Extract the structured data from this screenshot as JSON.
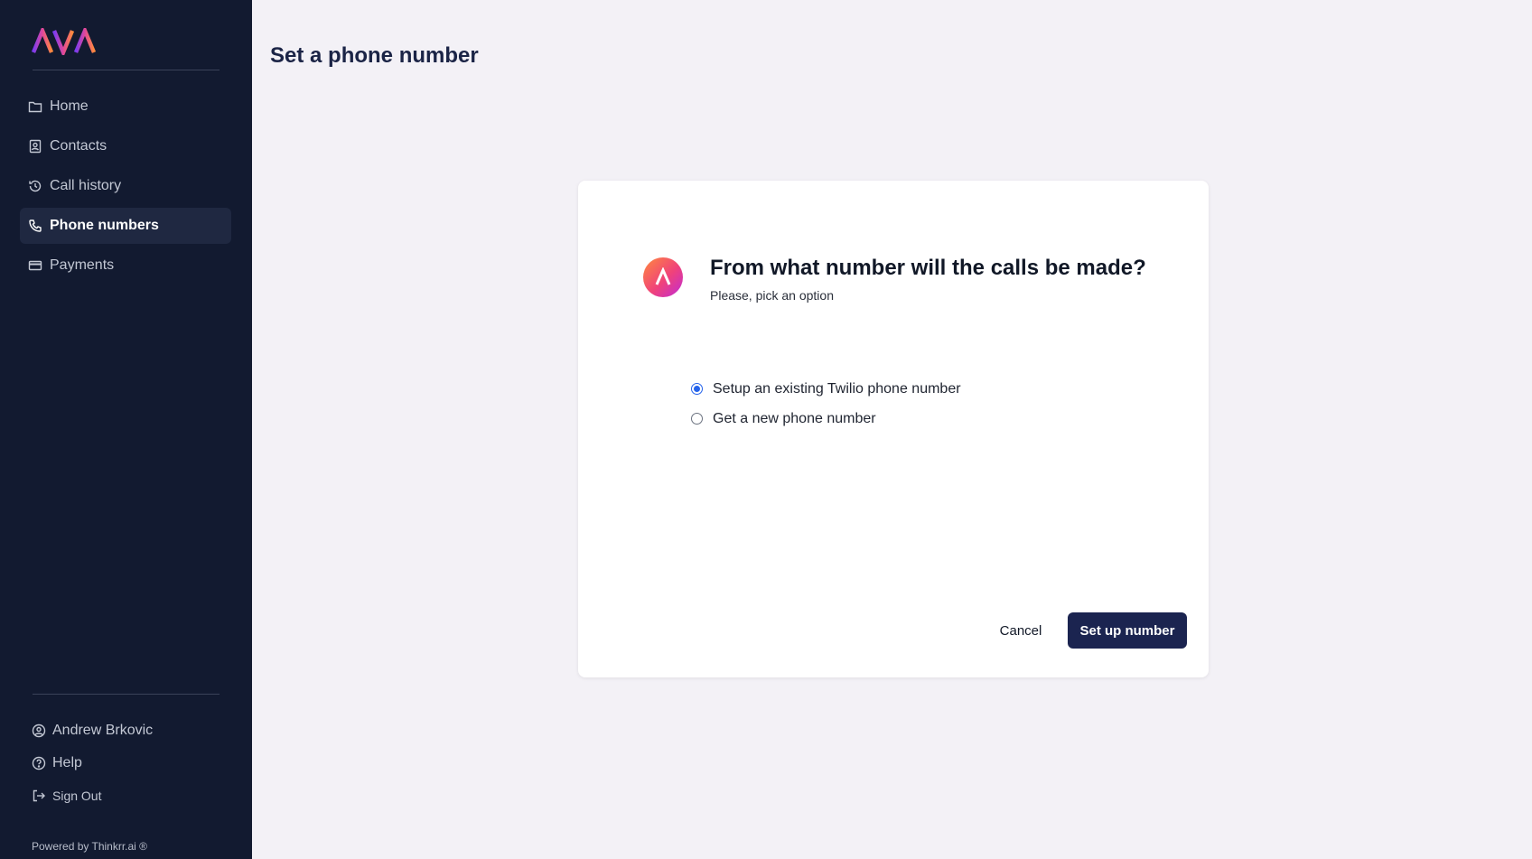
{
  "sidebar": {
    "logo_text": "AVA",
    "nav": [
      {
        "label": "Home",
        "icon": "folder-icon"
      },
      {
        "label": "Contacts",
        "icon": "contact-card-icon"
      },
      {
        "label": "Call history",
        "icon": "history-icon"
      },
      {
        "label": "Phone numbers",
        "icon": "phone-icon",
        "active": true
      },
      {
        "label": "Payments",
        "icon": "credit-card-icon"
      }
    ],
    "bottom": [
      {
        "label": "Andrew Brkovic",
        "icon": "user-circle-icon"
      },
      {
        "label": "Help",
        "icon": "help-circle-icon"
      },
      {
        "label": "Sign Out",
        "icon": "sign-out-icon"
      }
    ],
    "powered_by": "Powered by Thinkrr.ai ®"
  },
  "main": {
    "page_title": "Set a phone number"
  },
  "dialog": {
    "title": "From what number will the calls be made?",
    "subtitle": "Please, pick an option",
    "options": [
      {
        "label": "Setup an existing Twilio phone number",
        "selected": true
      },
      {
        "label": "Get a new phone number",
        "selected": false
      }
    ],
    "cancel_label": "Cancel",
    "submit_label": "Set up number"
  },
  "colors": {
    "sidebar_bg": "#121a30",
    "primary_button": "#1b2450",
    "radio_accent": "#2563eb",
    "page_bg": "#f3f1f6"
  }
}
